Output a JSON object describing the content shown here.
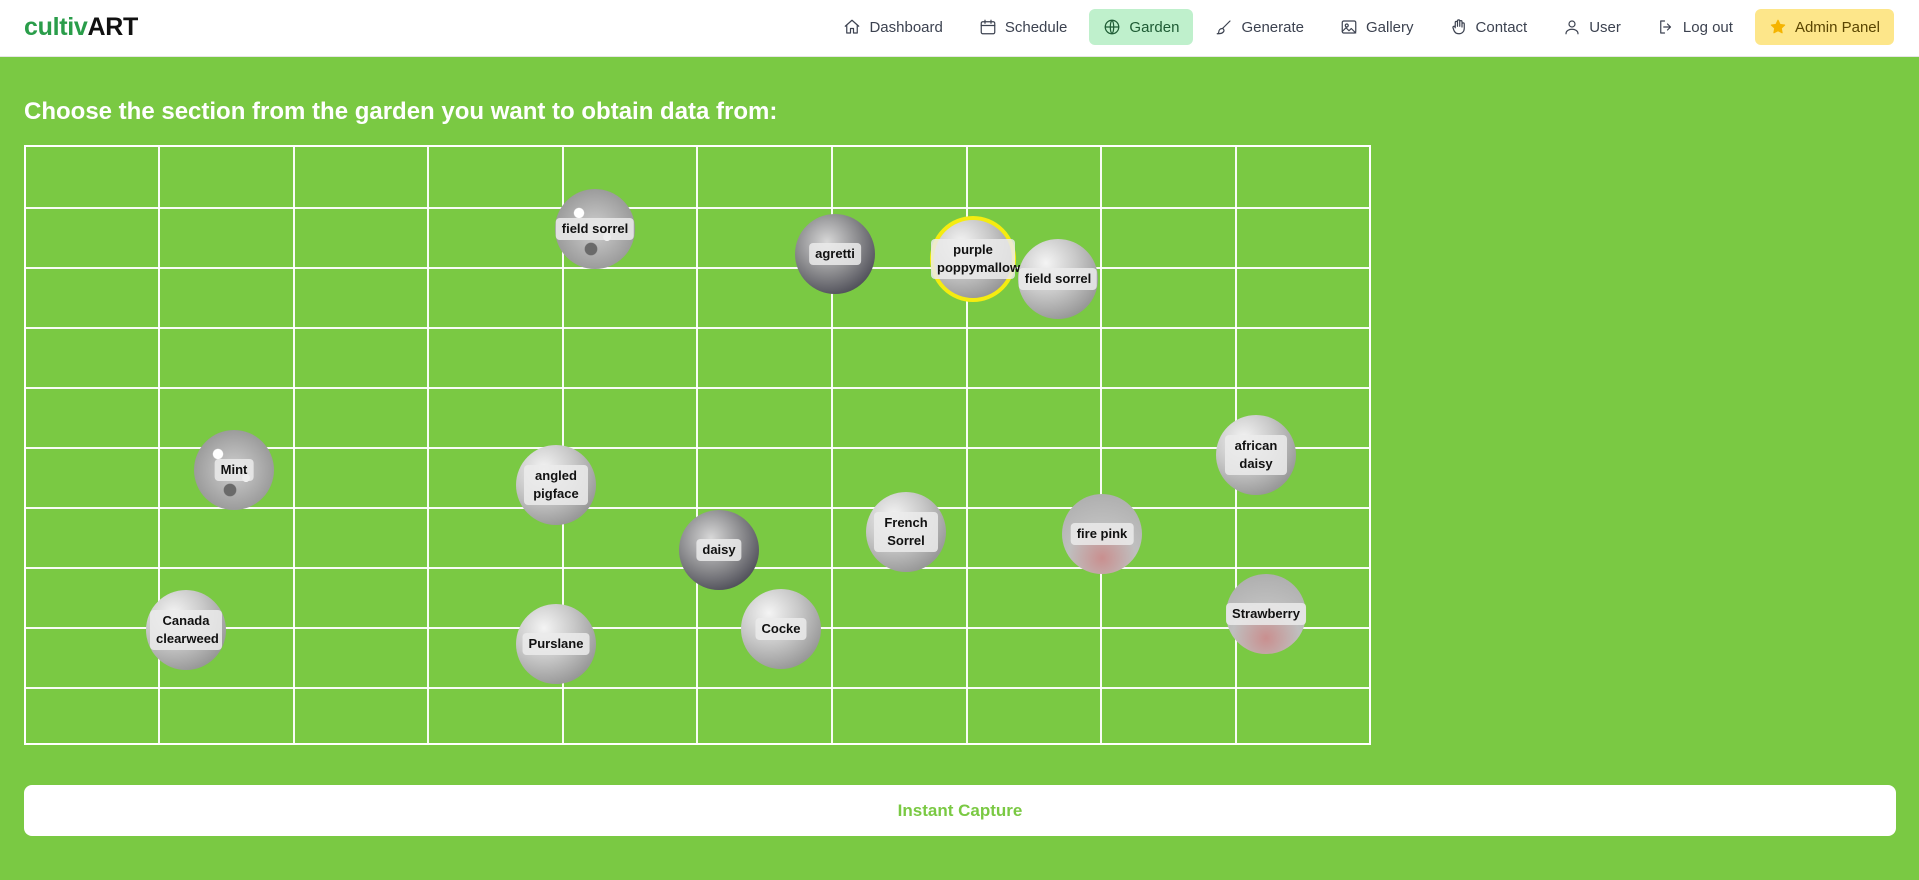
{
  "brand": {
    "part1": "cultiv",
    "part2": "ART"
  },
  "nav": {
    "dashboard": "Dashboard",
    "schedule": "Schedule",
    "garden": "Garden",
    "generate": "Generate",
    "gallery": "Gallery",
    "contact": "Contact",
    "user": "User",
    "logout": "Log out",
    "admin": "Admin Panel"
  },
  "heading": "Choose the section from the garden you want to obtain data from:",
  "plants": {
    "p1": "field sorrel",
    "p2": "agretti",
    "p3": "purple poppymallow",
    "p4": "field sorrel",
    "p5": "Mint",
    "p6": "angled pigface",
    "p7": "african daisy",
    "p8": "daisy",
    "p9": "French Sorrel",
    "p10": "fire pink",
    "p11": "Canada clearweed",
    "p12": "Purslane",
    "p13": "Cocke",
    "p14": "Strawberry"
  },
  "capture_label": "Instant Capture",
  "colors": {
    "background": "#7ac943",
    "selected_ring": "#f5ec10",
    "active_nav": "#bff0cc",
    "admin_nav": "#fde68a"
  },
  "icons": [
    "home-icon",
    "calendar-icon",
    "globe-icon",
    "brush-icon",
    "image-icon",
    "hand-icon",
    "user-icon",
    "logout-icon",
    "star-icon"
  ]
}
